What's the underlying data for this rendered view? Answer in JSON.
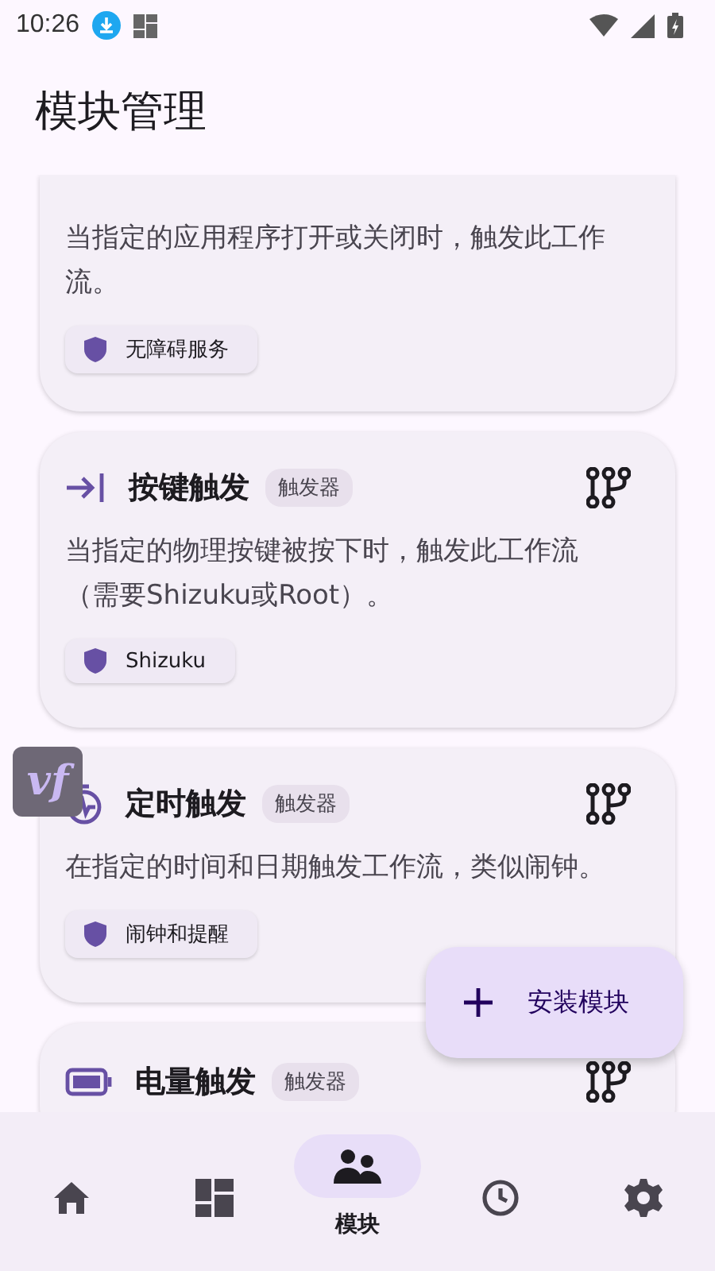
{
  "status_bar": {
    "time": "10:26"
  },
  "title": "模块管理",
  "modules": [
    {
      "kind": "partial",
      "description": "当指定的应用程序打开或关闭时，触发此工作流。",
      "permission": "无障碍服务"
    },
    {
      "kind": "full",
      "title": "按键触发",
      "badge": "触发器",
      "description": "当指定的物理按键被按下时，触发此工作流（需要Shizuku或Root）。",
      "permission": "Shizuku"
    },
    {
      "kind": "full",
      "title": "定时触发",
      "badge": "触发器",
      "description": "在指定的时间和日期触发工作流，类似闹钟。",
      "permission": "闹钟和提醒"
    },
    {
      "kind": "header",
      "title": "电量触发",
      "badge": "触发器"
    }
  ],
  "floating_bubble": {
    "label": "vf"
  },
  "fab": {
    "label": "安装模块"
  },
  "nav": [
    {
      "selected": false
    },
    {
      "selected": false
    },
    {
      "label": "模块",
      "selected": true
    },
    {
      "selected": false
    },
    {
      "selected": false
    }
  ]
}
